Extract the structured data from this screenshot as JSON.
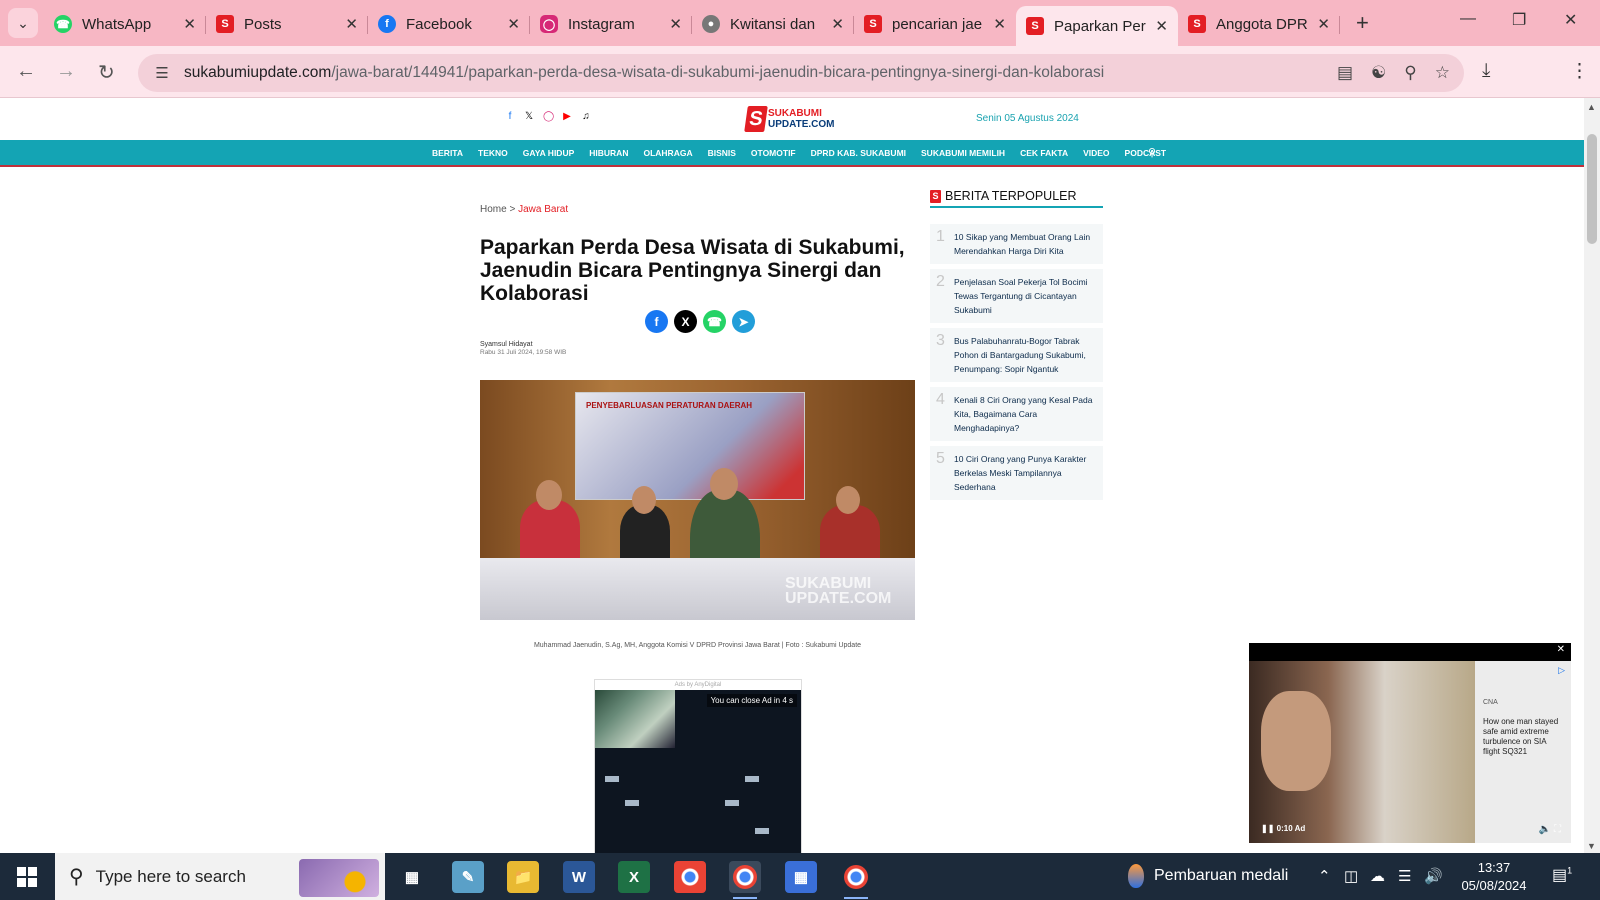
{
  "browser": {
    "tabs": [
      {
        "title": "WhatsApp",
        "icon": "whatsapp-icon",
        "color": "#25D366"
      },
      {
        "title": "Posts",
        "icon": "sukabumi-icon",
        "color": "#e31e24"
      },
      {
        "title": "Facebook",
        "icon": "facebook-icon",
        "color": "#1877F2"
      },
      {
        "title": "Instagram",
        "icon": "instagram-icon",
        "color": "#d62976"
      },
      {
        "title": "Kwitansi dan",
        "icon": "globe-icon",
        "color": "#777777"
      },
      {
        "title": "pencarian jae",
        "icon": "sukabumi-icon",
        "color": "#e31e24"
      },
      {
        "title": "Paparkan Per",
        "icon": "sukabumi-icon",
        "color": "#e31e24",
        "active": true
      },
      {
        "title": "Anggota DPR",
        "icon": "sukabumi-icon",
        "color": "#e31e24"
      }
    ],
    "url_host": "sukabumiupdate.com",
    "url_path": "/jawa-barat/144941/paparkan-perda-desa-wisata-di-sukabumi-jaenudin-bicara-pentingnya-sinergi-dan-kolaborasi"
  },
  "site": {
    "logo_line1": "SUKABUMI",
    "logo_line2": "UPDATE.COM",
    "date": "Senin 05 Agustus 2024",
    "social": [
      "facebook-icon",
      "x-icon",
      "instagram-icon",
      "youtube-icon",
      "tiktok-icon"
    ],
    "menu": [
      "BERITA",
      "TEKNO",
      "GAYA HIDUP",
      "HIBURAN",
      "OLAHRAGA",
      "BISNIS",
      "OTOMOTIF",
      "DPRD KAB. SUKABUMI",
      "SUKABUMI MEMILIH",
      "CEK FAKTA",
      "VIDEO",
      "PODCAST"
    ]
  },
  "article": {
    "breadcrumb_home": "Home",
    "breadcrumb_sep": ">",
    "breadcrumb_current": "Jawa Barat",
    "title": "Paparkan Perda Desa Wisata di Sukabumi, Jaenudin Bicara Pentingnya Sinergi dan Kolaborasi",
    "author": "Syamsul Hidayat",
    "published": "Rabu 31 Juli 2024, 19:58 WIB",
    "photo_banner": "PENYEBARLUASAN PERATURAN DAERAH",
    "photo_watermark": "SUKABUMI UPDATE.COM",
    "caption": "Muhammad Jaenudin, S.Ag, MH, Anggota Komisi V DPRD Provinsi Jawa Barat | Foto : Sukabumi Update",
    "ads_by": "Ads by AnyDigital",
    "ad_close": "You can close Ad in 4 s"
  },
  "sidebar": {
    "heading": "BERITA TERPOPULER",
    "items": [
      {
        "num": "1",
        "title": "10 Sikap yang Membuat Orang Lain Merendahkan Harga Diri Kita"
      },
      {
        "num": "2",
        "title": "Penjelasan Soal Pekerja Tol Bocimi Tewas Tergantung di Cicantayan Sukabumi"
      },
      {
        "num": "3",
        "title": "Bus Palabuhanratu-Bogor Tabrak Pohon di Bantargadung Sukabumi, Penumpang: Sopir Ngantuk"
      },
      {
        "num": "4",
        "title": "Kenali 8 Ciri Orang yang Kesal Pada Kita, Bagaimana Cara Menghadapinya?"
      },
      {
        "num": "5",
        "title": "10 Ciri Orang yang Punya Karakter Berkelas Meski Tampilannya Sederhana"
      }
    ]
  },
  "video_ad": {
    "source": "CNA",
    "headline": "How one man stayed safe amid extreme turbulence on SIA flight SQ321",
    "time": "0:10",
    "ad_label": "Ad"
  },
  "taskbar": {
    "search_placeholder": "Type here to search",
    "notification": "Pembaruan medali",
    "time": "13:37",
    "date": "05/08/2024",
    "notif_count": "1"
  }
}
